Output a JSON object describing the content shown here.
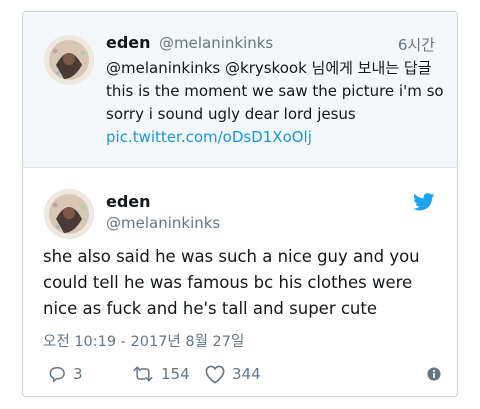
{
  "quoted_tweet": {
    "name": "eden",
    "handle": "@melaninkinks",
    "time": "6시간",
    "reply_line": "@melaninkinks @kryskook 님에게 보내는 답글",
    "text": "this is the moment we saw the picture i'm so sorry i sound ugly dear lord jesus",
    "link": "pic.twitter.com/oDsD1XoOlj"
  },
  "main_tweet": {
    "name": "eden",
    "handle": "@melaninkinks",
    "text": "she also said he was such a nice guy and you could tell he was famous bc his clothes were nice as fuck and he's tall and super cute",
    "date": "오전 10:19 - 2017년 8월 27일",
    "replies": "3",
    "retweets": "154",
    "likes": "344"
  },
  "icons": {
    "brand": "twitter-bird-icon",
    "reply": "reply-icon",
    "retweet": "retweet-icon",
    "like": "heart-icon",
    "info": "info-icon"
  },
  "colors": {
    "brand": "#1da1f2",
    "link": "#1b95e0",
    "secondary_text": "#657786",
    "quoted_background": "#f5f8fa"
  }
}
